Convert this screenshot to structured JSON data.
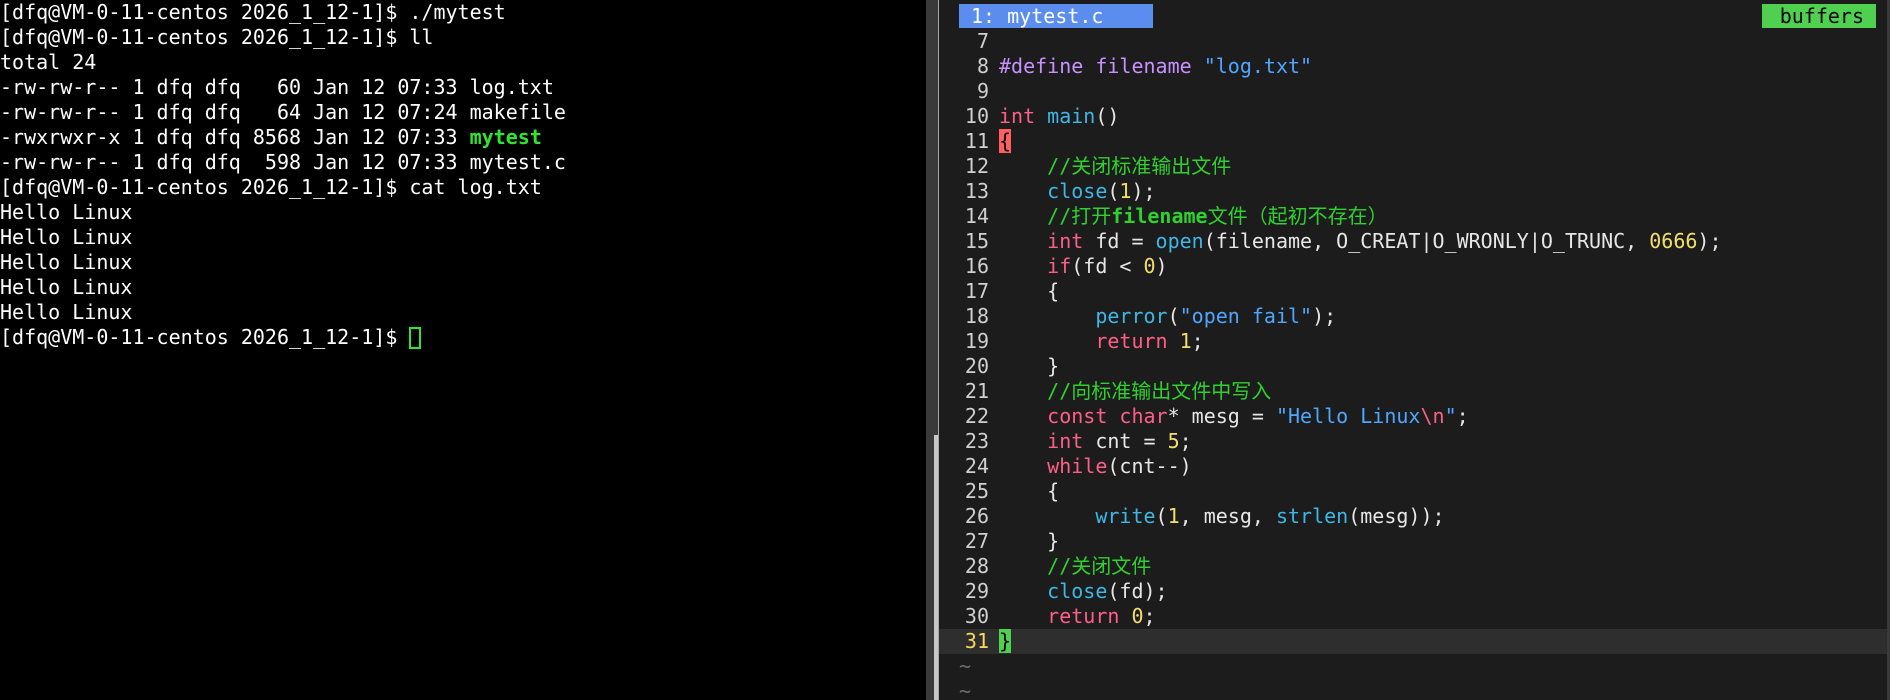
{
  "terminal": {
    "lines": [
      "[dfq@VM-0-11-centos 2026_1_12-1]$ ./mytest",
      "[dfq@VM-0-11-centos 2026_1_12-1]$ ll",
      "total 24",
      "-rw-rw-r-- 1 dfq dfq   60 Jan 12 07:33 log.txt",
      "-rw-rw-r-- 1 dfq dfq   64 Jan 12 07:24 makefile",
      "-rwxrwxr-x 1 dfq dfq 8568 Jan 12 07:33 ",
      "-rw-rw-r-- 1 dfq dfq  598 Jan 12 07:33 mytest.c",
      "[dfq@VM-0-11-centos 2026_1_12-1]$ cat log.txt",
      "Hello Linux",
      "Hello Linux",
      "Hello Linux",
      "Hello Linux",
      "Hello Linux",
      "[dfq@VM-0-11-centos 2026_1_12-1]$ "
    ],
    "exe_name": "mytest",
    "colors": {
      "exe": "#2fe52f",
      "cursor": "#2fe52f"
    }
  },
  "editor": {
    "tab_label": "1: mytest.c",
    "buffers_label": "buffers",
    "line_numbers": [
      "7",
      "8",
      "9",
      "10",
      "11",
      "12",
      "13",
      "14",
      "15",
      "16",
      "17",
      "18",
      "19",
      "20",
      "21",
      "22",
      "23",
      "24",
      "25",
      "26",
      "27",
      "28",
      "29",
      "30",
      "31"
    ],
    "tilde": "~",
    "code": {
      "l8_pp": "#define filename ",
      "l8_str": "\"log.txt\"",
      "l10_kw": "int",
      "l10_fn": "main",
      "l10_rest": "()",
      "l11_brace": "{",
      "l12_cmt": "    //关闭标准输出文件",
      "l13_fn": "    close",
      "l13_a": "(",
      "l13_num": "1",
      "l13_b": ");",
      "l14_cmt1": "    //打开",
      "l14_bold": "filename",
      "l14_cmt2": "文件（起初不存在）",
      "l15_kw": "    int",
      "l15_a": " fd = ",
      "l15_fn": "open",
      "l15_b": "(filename, O_CREAT|O_WRONLY|O_TRUNC, ",
      "l15_num": "0666",
      "l15_c": ");",
      "l16_kw": "    if",
      "l16_a": "(fd < ",
      "l16_num": "0",
      "l16_b": ")",
      "l17": "    {",
      "l18_fn": "        perror",
      "l18_a": "(",
      "l18_str": "\"open fail\"",
      "l18_b": ");",
      "l19_kw": "        return",
      "l19_a": " ",
      "l19_num": "1",
      "l19_b": ";",
      "l20": "    }",
      "l21_cmt": "    //向标准输出文件中写入",
      "l22_kw1": "    const",
      "l22_a": " ",
      "l22_kw2": "char",
      "l22_b": "* mesg = ",
      "l22_str": "\"Hello Linux",
      "l22_esc": "\\n",
      "l22_str2": "\"",
      "l22_c": ";",
      "l23_kw": "    int",
      "l23_a": " cnt = ",
      "l23_num": "5",
      "l23_b": ";",
      "l24_kw": "    while",
      "l24_a": "(cnt--)",
      "l25": "    {",
      "l26_fn1": "        write",
      "l26_a": "(",
      "l26_num": "1",
      "l26_b": ", mesg, ",
      "l26_fn2": "strlen",
      "l26_c": "(mesg));",
      "l27": "    }",
      "l28_cmt": "    //关闭文件",
      "l29_fn": "    close",
      "l29_a": "(fd);",
      "l30_kw": "    return",
      "l30_a": " ",
      "l30_num": "0",
      "l30_b": ";",
      "l31_brace": "}"
    },
    "colors": {
      "tab_bg": "#5b8def",
      "buffers_bg": "#4fd14f",
      "keyword": "#ff5f87",
      "function": "#3fb7e6",
      "string": "#4ea6ff",
      "number": "#f0e06a",
      "comment": "#2fd12f"
    }
  }
}
